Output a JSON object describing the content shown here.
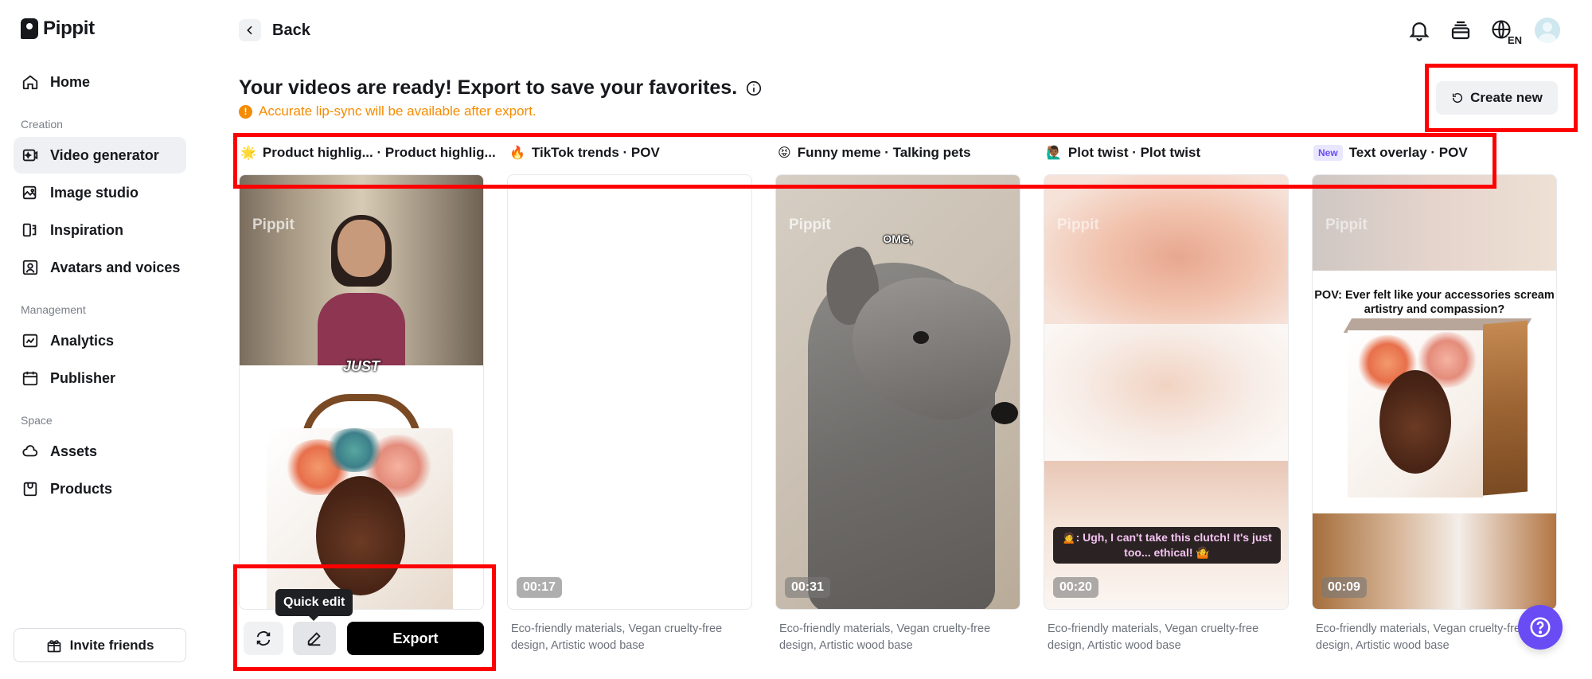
{
  "app": {
    "name": "Pippit"
  },
  "sidebar": {
    "home": "Home",
    "sections": {
      "creation": "Creation",
      "management": "Management",
      "space": "Space"
    },
    "items": {
      "video_generator": "Video generator",
      "image_studio": "Image studio",
      "inspiration": "Inspiration",
      "avatars_voices": "Avatars and voices",
      "analytics": "Analytics",
      "publisher": "Publisher",
      "assets": "Assets",
      "products": "Products"
    },
    "invite": "Invite friends"
  },
  "header": {
    "back": "Back",
    "language": "EN"
  },
  "main": {
    "headline": "Your videos are ready! Export to save your favorites.",
    "note": "Accurate lip-sync will be available after export.",
    "create_new": "Create new"
  },
  "columns": [
    {
      "emoji": "🌟",
      "title": "Product highlig...  · Product highlig...",
      "duration": "",
      "desc": ""
    },
    {
      "emoji": "🔥",
      "title": "TikTok trends · POV",
      "duration": "00:17",
      "desc": "Eco-friendly materials, Vegan cruelty-free design, Artistic wood base"
    },
    {
      "emoji": "😝",
      "title": "Funny meme · Talking pets",
      "duration": "00:31",
      "desc": "Eco-friendly materials, Vegan cruelty-free design, Artistic wood base"
    },
    {
      "emoji": "🙋🏾‍♂️",
      "title": "Plot twist · Plot twist",
      "duration": "00:20",
      "desc": "Eco-friendly materials, Vegan cruelty-free design, Artistic wood base"
    },
    {
      "badge": "New",
      "title": "Text overlay · POV",
      "duration": "00:09",
      "desc": "Eco-friendly materials, Vegan cruelty-free design, Artistic wood base"
    }
  ],
  "cards": {
    "watermark": "Pippit",
    "card1_caption": "JUST",
    "card3_caption": "OMG,",
    "card4_subtitle": "🙍: Ugh, I can't take this clutch! It's just too... ethical! 🤷",
    "card5_caption": "POV: Ever felt like your accessories scream artistry and compassion?"
  },
  "actions": {
    "tooltip": "Quick edit",
    "export": "Export"
  }
}
